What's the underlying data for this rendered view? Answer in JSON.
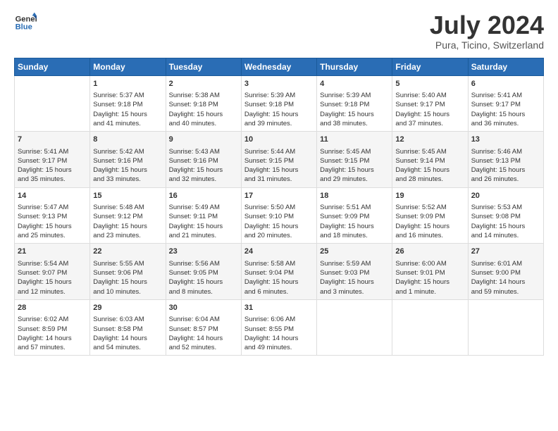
{
  "logo": {
    "line1": "General",
    "line2": "Blue"
  },
  "title": "July 2024",
  "subtitle": "Pura, Ticino, Switzerland",
  "days_header": [
    "Sunday",
    "Monday",
    "Tuesday",
    "Wednesday",
    "Thursday",
    "Friday",
    "Saturday"
  ],
  "weeks": [
    [
      {
        "day": "",
        "content": ""
      },
      {
        "day": "1",
        "content": "Sunrise: 5:37 AM\nSunset: 9:18 PM\nDaylight: 15 hours\nand 41 minutes."
      },
      {
        "day": "2",
        "content": "Sunrise: 5:38 AM\nSunset: 9:18 PM\nDaylight: 15 hours\nand 40 minutes."
      },
      {
        "day": "3",
        "content": "Sunrise: 5:39 AM\nSunset: 9:18 PM\nDaylight: 15 hours\nand 39 minutes."
      },
      {
        "day": "4",
        "content": "Sunrise: 5:39 AM\nSunset: 9:18 PM\nDaylight: 15 hours\nand 38 minutes."
      },
      {
        "day": "5",
        "content": "Sunrise: 5:40 AM\nSunset: 9:17 PM\nDaylight: 15 hours\nand 37 minutes."
      },
      {
        "day": "6",
        "content": "Sunrise: 5:41 AM\nSunset: 9:17 PM\nDaylight: 15 hours\nand 36 minutes."
      }
    ],
    [
      {
        "day": "7",
        "content": "Sunrise: 5:41 AM\nSunset: 9:17 PM\nDaylight: 15 hours\nand 35 minutes."
      },
      {
        "day": "8",
        "content": "Sunrise: 5:42 AM\nSunset: 9:16 PM\nDaylight: 15 hours\nand 33 minutes."
      },
      {
        "day": "9",
        "content": "Sunrise: 5:43 AM\nSunset: 9:16 PM\nDaylight: 15 hours\nand 32 minutes."
      },
      {
        "day": "10",
        "content": "Sunrise: 5:44 AM\nSunset: 9:15 PM\nDaylight: 15 hours\nand 31 minutes."
      },
      {
        "day": "11",
        "content": "Sunrise: 5:45 AM\nSunset: 9:15 PM\nDaylight: 15 hours\nand 29 minutes."
      },
      {
        "day": "12",
        "content": "Sunrise: 5:45 AM\nSunset: 9:14 PM\nDaylight: 15 hours\nand 28 minutes."
      },
      {
        "day": "13",
        "content": "Sunrise: 5:46 AM\nSunset: 9:13 PM\nDaylight: 15 hours\nand 26 minutes."
      }
    ],
    [
      {
        "day": "14",
        "content": "Sunrise: 5:47 AM\nSunset: 9:13 PM\nDaylight: 15 hours\nand 25 minutes."
      },
      {
        "day": "15",
        "content": "Sunrise: 5:48 AM\nSunset: 9:12 PM\nDaylight: 15 hours\nand 23 minutes."
      },
      {
        "day": "16",
        "content": "Sunrise: 5:49 AM\nSunset: 9:11 PM\nDaylight: 15 hours\nand 21 minutes."
      },
      {
        "day": "17",
        "content": "Sunrise: 5:50 AM\nSunset: 9:10 PM\nDaylight: 15 hours\nand 20 minutes."
      },
      {
        "day": "18",
        "content": "Sunrise: 5:51 AM\nSunset: 9:09 PM\nDaylight: 15 hours\nand 18 minutes."
      },
      {
        "day": "19",
        "content": "Sunrise: 5:52 AM\nSunset: 9:09 PM\nDaylight: 15 hours\nand 16 minutes."
      },
      {
        "day": "20",
        "content": "Sunrise: 5:53 AM\nSunset: 9:08 PM\nDaylight: 15 hours\nand 14 minutes."
      }
    ],
    [
      {
        "day": "21",
        "content": "Sunrise: 5:54 AM\nSunset: 9:07 PM\nDaylight: 15 hours\nand 12 minutes."
      },
      {
        "day": "22",
        "content": "Sunrise: 5:55 AM\nSunset: 9:06 PM\nDaylight: 15 hours\nand 10 minutes."
      },
      {
        "day": "23",
        "content": "Sunrise: 5:56 AM\nSunset: 9:05 PM\nDaylight: 15 hours\nand 8 minutes."
      },
      {
        "day": "24",
        "content": "Sunrise: 5:58 AM\nSunset: 9:04 PM\nDaylight: 15 hours\nand 6 minutes."
      },
      {
        "day": "25",
        "content": "Sunrise: 5:59 AM\nSunset: 9:03 PM\nDaylight: 15 hours\nand 3 minutes."
      },
      {
        "day": "26",
        "content": "Sunrise: 6:00 AM\nSunset: 9:01 PM\nDaylight: 15 hours\nand 1 minute."
      },
      {
        "day": "27",
        "content": "Sunrise: 6:01 AM\nSunset: 9:00 PM\nDaylight: 14 hours\nand 59 minutes."
      }
    ],
    [
      {
        "day": "28",
        "content": "Sunrise: 6:02 AM\nSunset: 8:59 PM\nDaylight: 14 hours\nand 57 minutes."
      },
      {
        "day": "29",
        "content": "Sunrise: 6:03 AM\nSunset: 8:58 PM\nDaylight: 14 hours\nand 54 minutes."
      },
      {
        "day": "30",
        "content": "Sunrise: 6:04 AM\nSunset: 8:57 PM\nDaylight: 14 hours\nand 52 minutes."
      },
      {
        "day": "31",
        "content": "Sunrise: 6:06 AM\nSunset: 8:55 PM\nDaylight: 14 hours\nand 49 minutes."
      },
      {
        "day": "",
        "content": ""
      },
      {
        "day": "",
        "content": ""
      },
      {
        "day": "",
        "content": ""
      }
    ]
  ]
}
